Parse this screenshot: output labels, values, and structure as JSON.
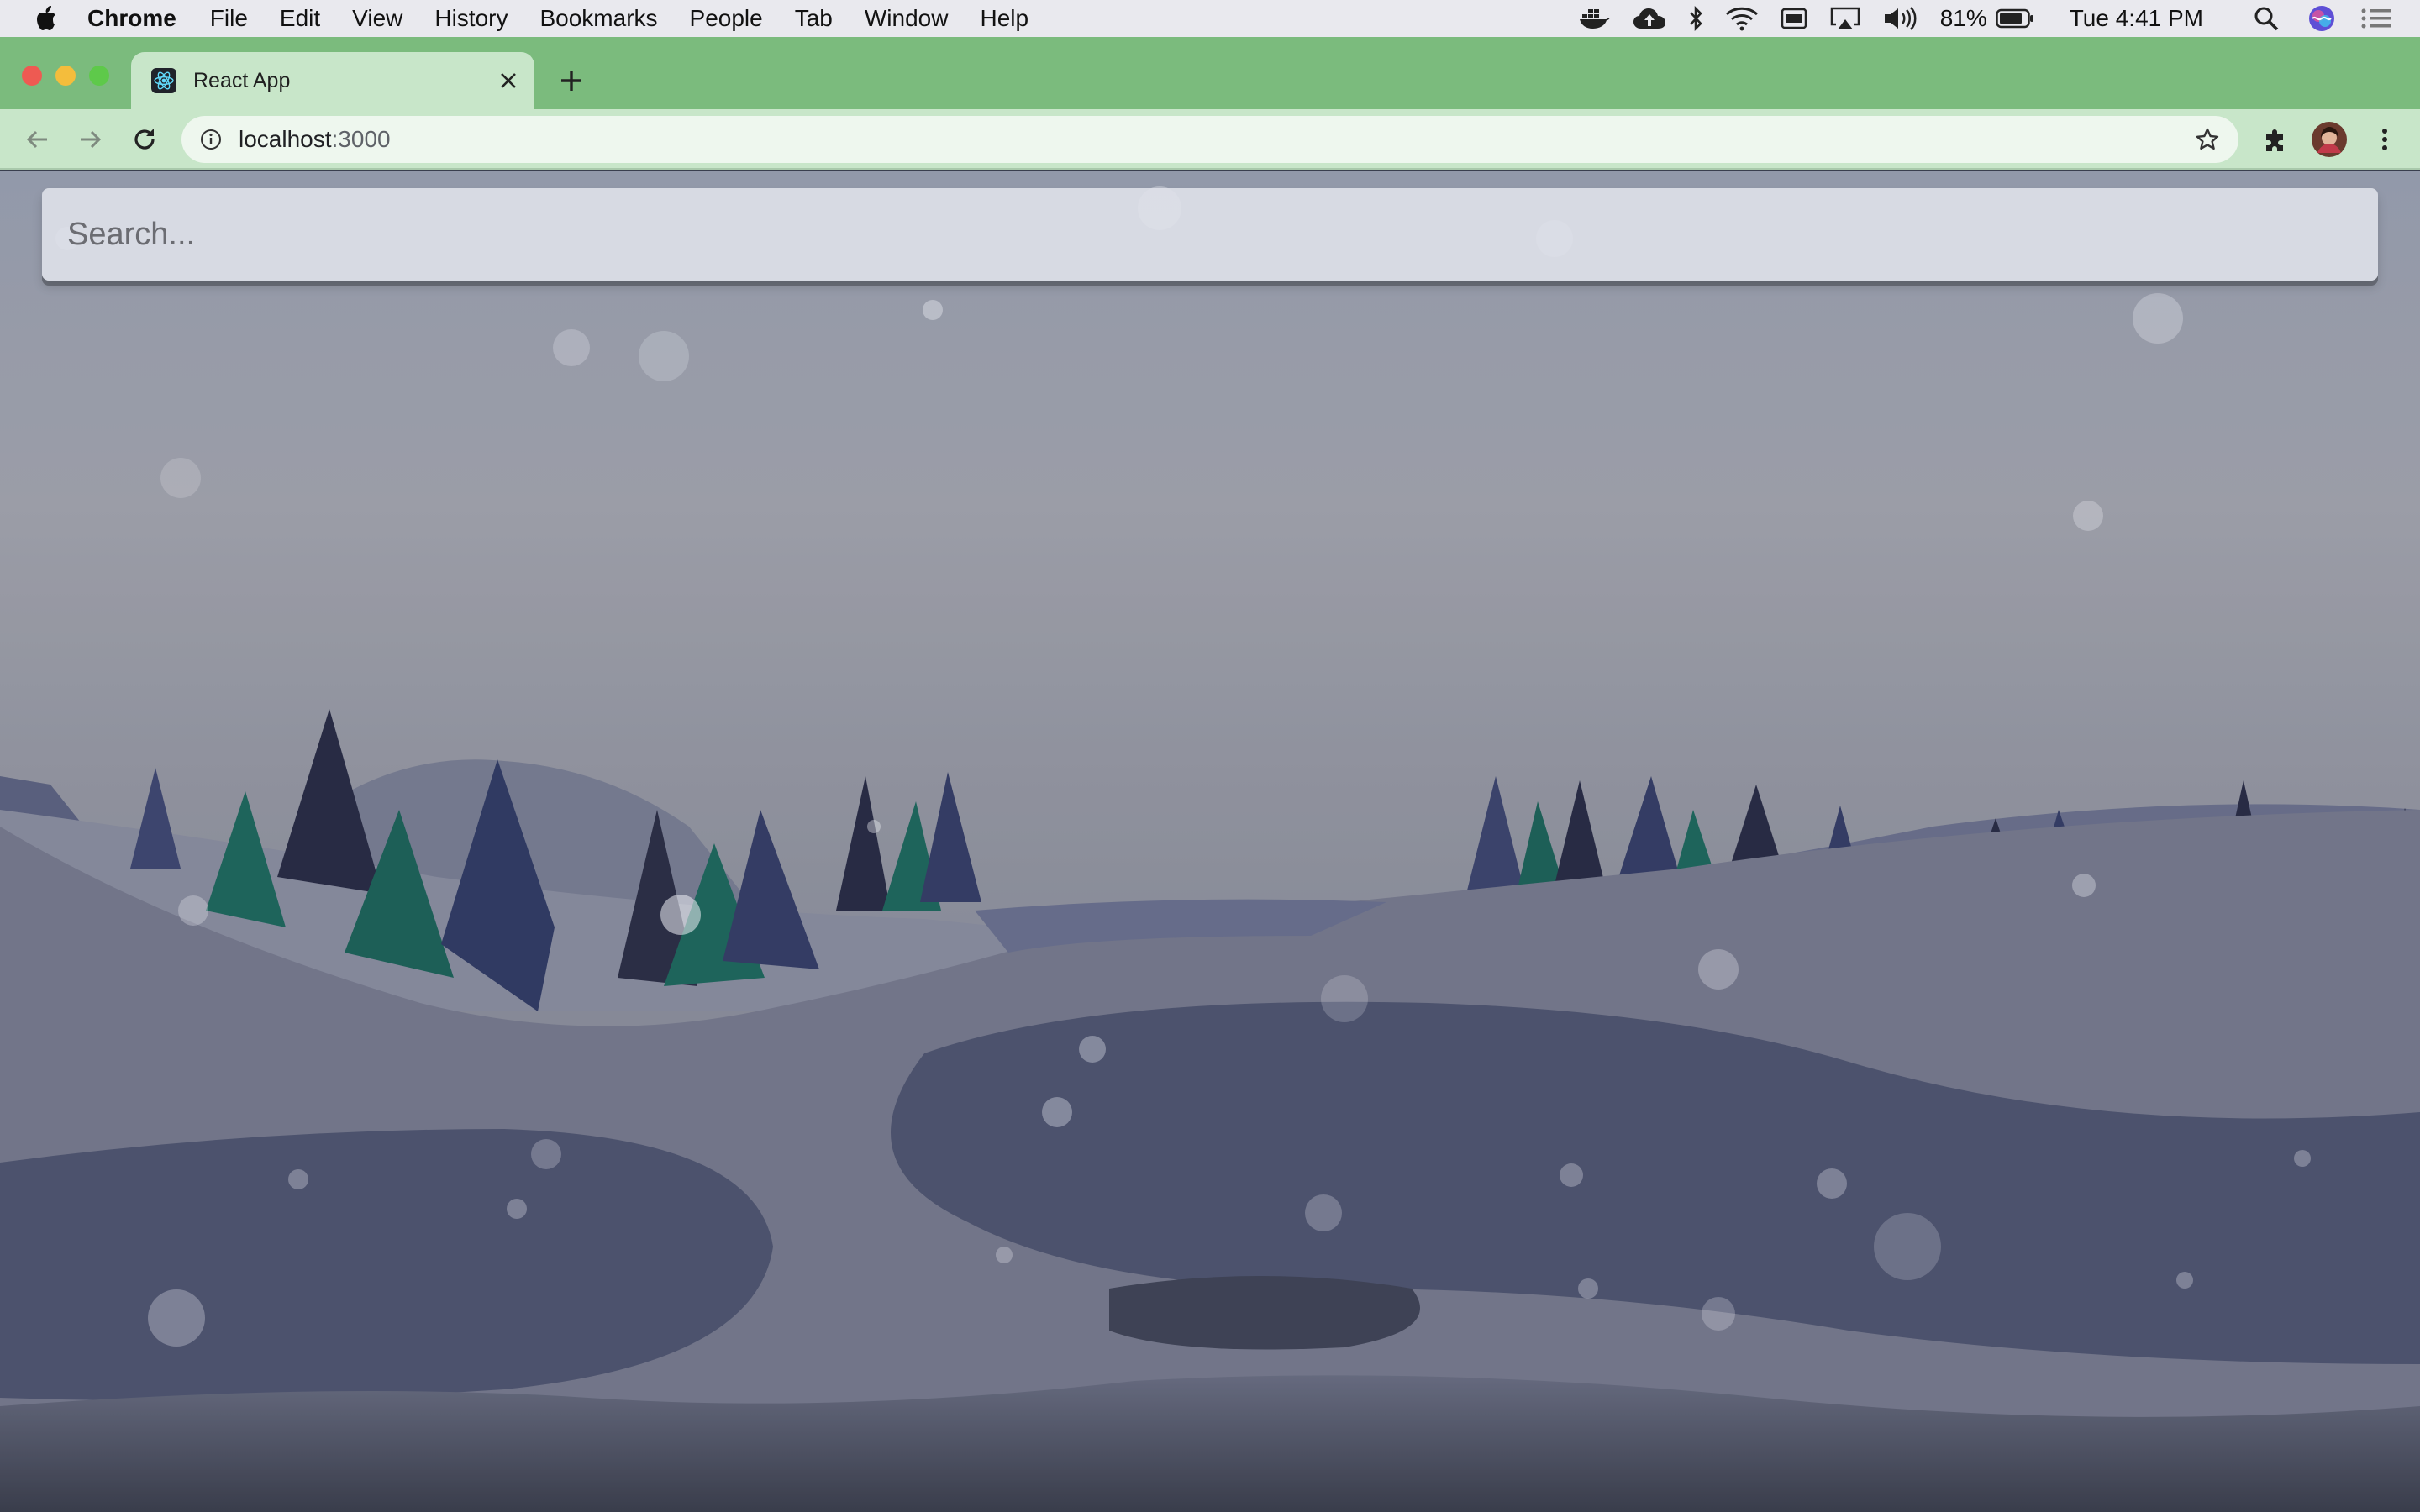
{
  "menubar": {
    "app_name": "Chrome",
    "items": [
      "File",
      "Edit",
      "View",
      "History",
      "Bookmarks",
      "People",
      "Tab",
      "Window",
      "Help"
    ],
    "battery_percent": "81%",
    "clock": "Tue 4:41 PM",
    "status_icons": [
      "docker-icon",
      "cloud-upload-icon",
      "bluetooth-icon",
      "wifi-icon",
      "keyboard-icon",
      "airplay-icon",
      "volume-icon",
      "battery-icon",
      "spotlight-icon",
      "siri-icon",
      "notification-center-icon"
    ]
  },
  "browser": {
    "tab": {
      "title": "React App",
      "close_label": "×"
    },
    "new_tab_icon": "plus-icon",
    "address": {
      "host": "localhost",
      "port": ":3000"
    },
    "accent_color": "#7bbb7d",
    "tab_color": "#c8e6c9"
  },
  "page": {
    "search": {
      "placeholder": "Search..."
    },
    "background": "winter-landscape-illustration"
  }
}
